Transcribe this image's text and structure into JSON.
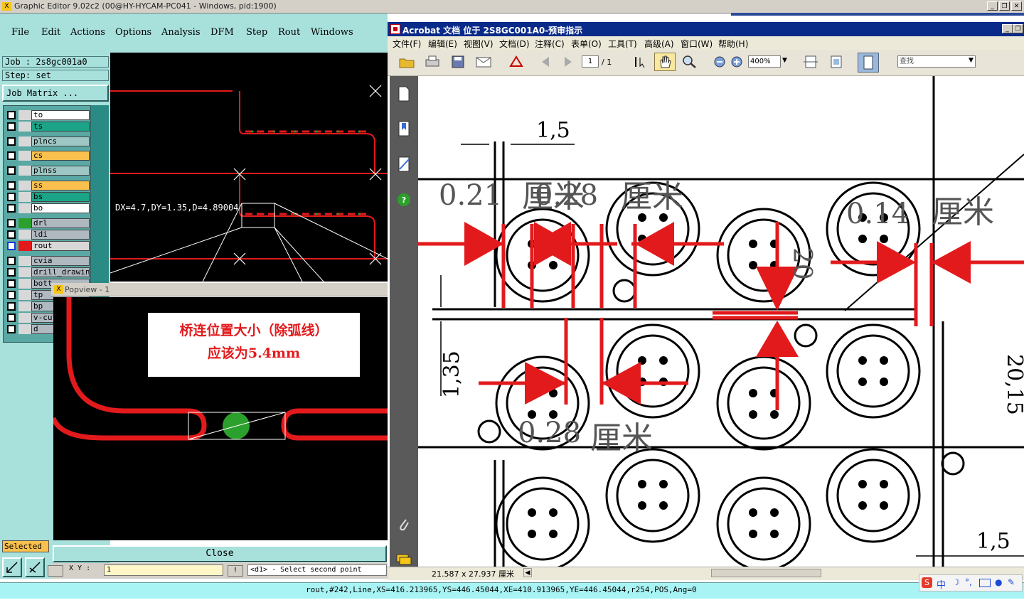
{
  "ge": {
    "title": "Graphic Editor 9.02c2 (00@HY-HYCAM-PC041 - Windows, pid:1900)",
    "menu": [
      "File",
      "Edit",
      "Actions",
      "Options",
      "Analysis",
      "DFM",
      "Step",
      "Rout",
      "Windows"
    ],
    "job": "Job : 2s8gc001a0",
    "step": "Step: set",
    "job_matrix_label": "Job Matrix ...",
    "layers": [
      {
        "name": "to",
        "color": "#d8d8d8",
        "name_bg": "#ffffff"
      },
      {
        "name": "ts",
        "color": "#d8d8d8",
        "name_bg": "#1ba487"
      },
      {
        "name": "plncs",
        "color": "#d8d8d8",
        "name_bg": "#9dc6c4"
      },
      {
        "name": "cs",
        "color": "#d8d8d8",
        "name_bg": "#f9c04e"
      },
      {
        "name": "plnss",
        "color": "#d8d8d8",
        "name_bg": "#9dc6c4"
      },
      {
        "name": "ss",
        "color": "#d8d8d8",
        "name_bg": "#f9c04e"
      },
      {
        "name": "bs",
        "color": "#d8d8d8",
        "name_bg": "#1ba487"
      },
      {
        "name": "bo",
        "color": "#d8d8d8",
        "name_bg": "#ffffff"
      },
      {
        "name": "drl",
        "color": "#2ca02c",
        "name_bg": "#b0b8c0"
      },
      {
        "name": "ldi",
        "color": "#d8d8d8",
        "name_bg": "#b0b8c0"
      },
      {
        "name": "rout",
        "color": "#e31a1c",
        "name_bg": "#d8d8d8"
      },
      {
        "name": "cvia",
        "color": "#d8d8d8",
        "name_bg": "#b0b8c0"
      },
      {
        "name": "drill_drawing",
        "color": "#d8d8d8",
        "name_bg": "#b0b8c0"
      },
      {
        "name": "bott",
        "color": "#d8d8d8",
        "name_bg": "#b0b8c0"
      },
      {
        "name": "tp",
        "color": "#d8d8d8",
        "name_bg": "#b0b8c0"
      },
      {
        "name": "bp",
        "color": "#d8d8d8",
        "name_bg": "#b0b8c0"
      },
      {
        "name": "v-cut",
        "color": "#d8d8d8",
        "name_bg": "#b0b8c0"
      },
      {
        "name": "d",
        "color": "#d8d8d8",
        "name_bg": "#b0b8c0"
      }
    ],
    "measure_text": "DX=4.7,DY=1.35,D=4.89004",
    "selected_label": "Selected",
    "cmd_prefix": "X Y :",
    "cmd_value": "1",
    "cmd_prompt": "<d1> - Select second point",
    "status": "rout,#242,Line,XS=416.213965,YS=446.45044,XE=410.913965,YE=446.45044,r254,POS,Ang=0"
  },
  "popview": {
    "title": "Popview - 1",
    "note_line1": "桥连位置大小（除弧线）",
    "note_line2": "应该为5.4mm",
    "close_label": "Close"
  },
  "acrobat": {
    "title": "Acrobat 文档 位于 2S8GC001A0-预审指示",
    "menu": [
      "文件(F)",
      "编辑(E)",
      "视图(V)",
      "文档(D)",
      "注释(C)",
      "表单(O)",
      "工具(T)",
      "高级(A)",
      "窗口(W)",
      "帮助(H)"
    ],
    "page_current": "1",
    "page_total": "/ 1",
    "zoom": "400%",
    "search_placeholder": "查找",
    "doc_size": "21.587 x 27.937 厘米",
    "labels": {
      "dim_top": "1,5",
      "dim_021": "0.21",
      "unit_cm": "厘米",
      "dim_028a": "0.28",
      "dim_014": "0.14",
      "dim_20": "20",
      "dim_135": "1,35",
      "dim_028b": "0.28",
      "dim_2015": "20,15",
      "dim_bottom": "1,5"
    }
  },
  "colors": {
    "ge_bg": "#a8e0dc",
    "rout_red": "#e31a1c",
    "acrobat_blue": "#0a2a8a"
  }
}
